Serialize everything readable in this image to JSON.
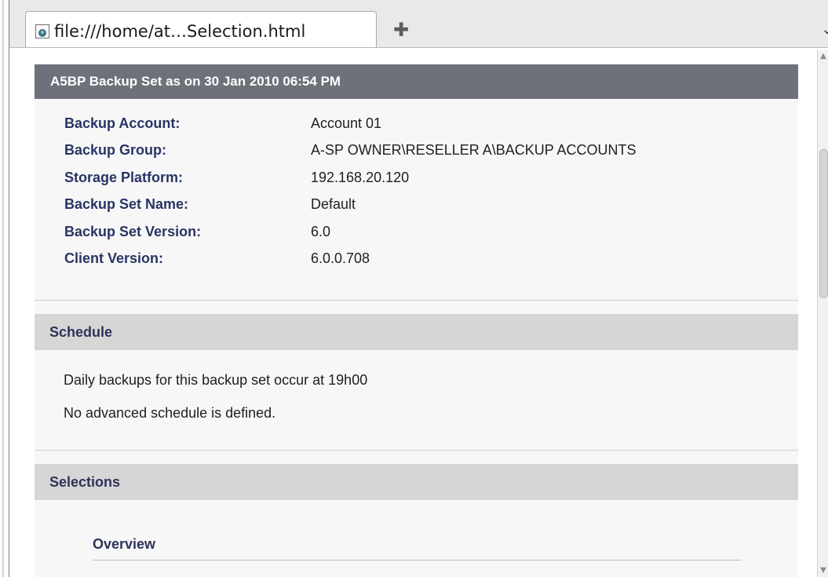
{
  "browser": {
    "tab_title": "file:///home/at…Selection.html",
    "new_tab_glyph": "✚",
    "tab_list_glyph": "⌄",
    "icons": {
      "page": "page-icon",
      "new_tab": "plus-icon",
      "tab_list": "chevron-down-icon"
    },
    "scroll_up_glyph": "▲",
    "scroll_down_glyph": "▼"
  },
  "report": {
    "title": "A5BP Backup Set as on 30 Jan 2010 06:54 PM",
    "info": [
      {
        "label": "Backup Account:",
        "value": "Account 01"
      },
      {
        "label": "Backup Group:",
        "value": "A-SP OWNER\\RESELLER A\\BACKUP ACCOUNTS"
      },
      {
        "label": "Storage Platform:",
        "value": "192.168.20.120"
      },
      {
        "label": "Backup Set Name:",
        "value": "Default"
      },
      {
        "label": "Backup Set Version:",
        "value": "6.0"
      },
      {
        "label": "Client Version:",
        "value": "6.0.0.708"
      }
    ],
    "schedule": {
      "heading": "Schedule",
      "lines": [
        "Daily backups for this backup set occur at 19h00",
        "No advanced schedule is defined."
      ]
    },
    "selections": {
      "heading": "Selections",
      "overview_heading": "Overview"
    }
  },
  "colors": {
    "header_bar": "#6e7179",
    "section_header": "#d6d6d6",
    "label_text": "#283565",
    "content_bg": "#f7f7f7"
  }
}
